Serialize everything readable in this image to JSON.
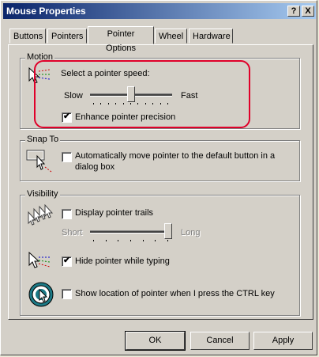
{
  "window": {
    "title": "Mouse Properties"
  },
  "titlebar_buttons": {
    "help": "?",
    "close": "X"
  },
  "tabs": [
    "Buttons",
    "Pointers",
    "Pointer Options",
    "Wheel",
    "Hardware"
  ],
  "motion": {
    "legend": "Motion",
    "speed_label": "Select a pointer speed:",
    "slow_label": "Slow",
    "fast_label": "Fast",
    "speed_level": 0.5,
    "enhance_label": "Enhance pointer precision",
    "enhance_checked": true
  },
  "snap_to": {
    "legend": "Snap To",
    "label_line1": "Automatically move pointer to the default button in a",
    "label_line2": "dialog box",
    "checked": false
  },
  "visibility": {
    "legend": "Visibility",
    "trails_label": "Display pointer trails",
    "trails_checked": false,
    "short_label": "Short",
    "long_label": "Long",
    "trail_level": 1.0,
    "hide_label": "Hide pointer while typing",
    "hide_checked": true,
    "ctrl_label": "Show location of pointer when I press the CTRL key",
    "ctrl_checked": false
  },
  "buttons": {
    "ok": "OK",
    "cancel": "Cancel",
    "apply": "Apply"
  }
}
